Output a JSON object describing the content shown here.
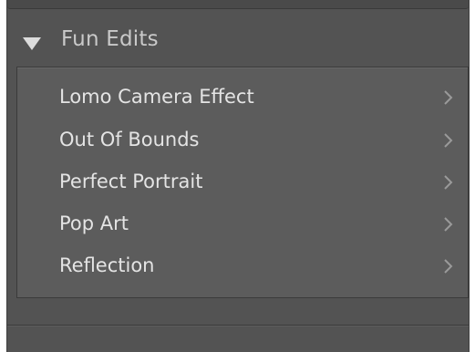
{
  "section": {
    "title": "Fun Edits",
    "expanded_icon": "triangle-down-icon"
  },
  "items": [
    {
      "label": "Lomo Camera Effect",
      "icon": "chevron-right-icon"
    },
    {
      "label": "Out Of Bounds",
      "icon": "chevron-right-icon"
    },
    {
      "label": "Perfect Portrait",
      "icon": "chevron-right-icon"
    },
    {
      "label": "Pop Art",
      "icon": "chevron-right-icon"
    },
    {
      "label": "Reflection",
      "icon": "chevron-right-icon"
    }
  ],
  "colors": {
    "panel_bg": "#535353",
    "list_bg": "#5c5c5c",
    "text": "#e4e4e4",
    "header_text": "#c9c9c9"
  }
}
